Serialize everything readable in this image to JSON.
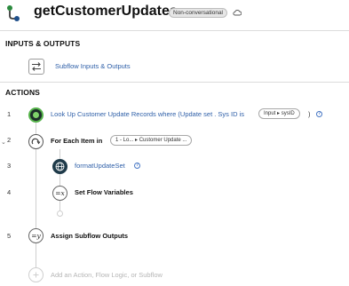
{
  "header": {
    "title": "getCustomerUpdates",
    "badge": "Non-conversational",
    "logo_icon": "flow-logo-icon",
    "cloud_icon": "cloud-icon"
  },
  "inputs_outputs": {
    "heading": "INPUTS & OUTPUTS",
    "item_label": "Subflow Inputs & Outputs",
    "item_icon": "swap-arrows-icon"
  },
  "actions": {
    "heading": "ACTIONS",
    "steps": [
      {
        "number": "1",
        "icon": "lookup-records-icon",
        "prefix": "Look Up Customer Update Records where (Update set . Sys ID is",
        "pill": "Input ▸ sysID",
        "suffix": ")",
        "info": "?"
      },
      {
        "number": "2",
        "icon": "for-each-icon",
        "label": "For Each Item in",
        "pill": "1 - Lo... ▸ Customer Update ...",
        "caret": "⌄"
      },
      {
        "number": "3",
        "icon": "globe-icon",
        "label": "formatUpdateSet",
        "info": "?"
      },
      {
        "number": "4",
        "icon": "set-variable-icon",
        "glyph": "=x",
        "label": "Set Flow Variables"
      },
      {
        "number": "5",
        "icon": "assign-outputs-icon",
        "glyph": "=y",
        "label": "Assign Subflow Outputs"
      }
    ],
    "add_placeholder": "Add an Action, Flow Logic, or Subflow"
  },
  "colors": {
    "link": "#2e5fa8",
    "lookup_ring": "#55b24a",
    "action_bg": "#1f3b4a",
    "muted": "#b5b5b5"
  }
}
